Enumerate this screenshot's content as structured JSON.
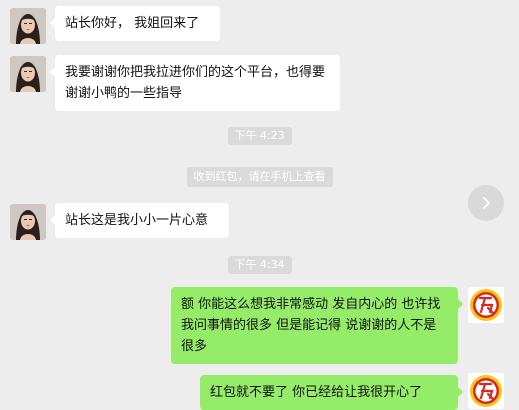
{
  "messages": [
    {
      "side": "left",
      "text": "站长你好， 我姐回来了"
    },
    {
      "side": "left",
      "text": "我要谢谢你把我拉进你们的这个平台，也得要谢谢小鸭的一些指导"
    },
    {
      "side": "left",
      "text": "站长这是我小小一片心意"
    },
    {
      "side": "right",
      "text": "额  你能这么想我非常感动  发自内心的   也许找我问事情的很多 但是能记得  说谢谢的人不是很多"
    },
    {
      "side": "right",
      "text": "红包就不要了  你已经给让我很开心了"
    }
  ],
  "timestamps": [
    "下午 4:23",
    "下午 4:34"
  ],
  "system_note": "收到红包，请在手机上查看",
  "colors": {
    "background": "#ededed",
    "incoming_bubble": "#ffffff",
    "outgoing_bubble": "#95ec69",
    "timestamp_bg": "#dadada",
    "avatar_badge_red": "#d7281f",
    "avatar_badge_yellow": "#f5c518"
  },
  "icons": {
    "contact_avatar": "woman-portrait-avatar",
    "self_avatar": "red-badge-avatar",
    "next_button": "chevron-right-icon"
  }
}
